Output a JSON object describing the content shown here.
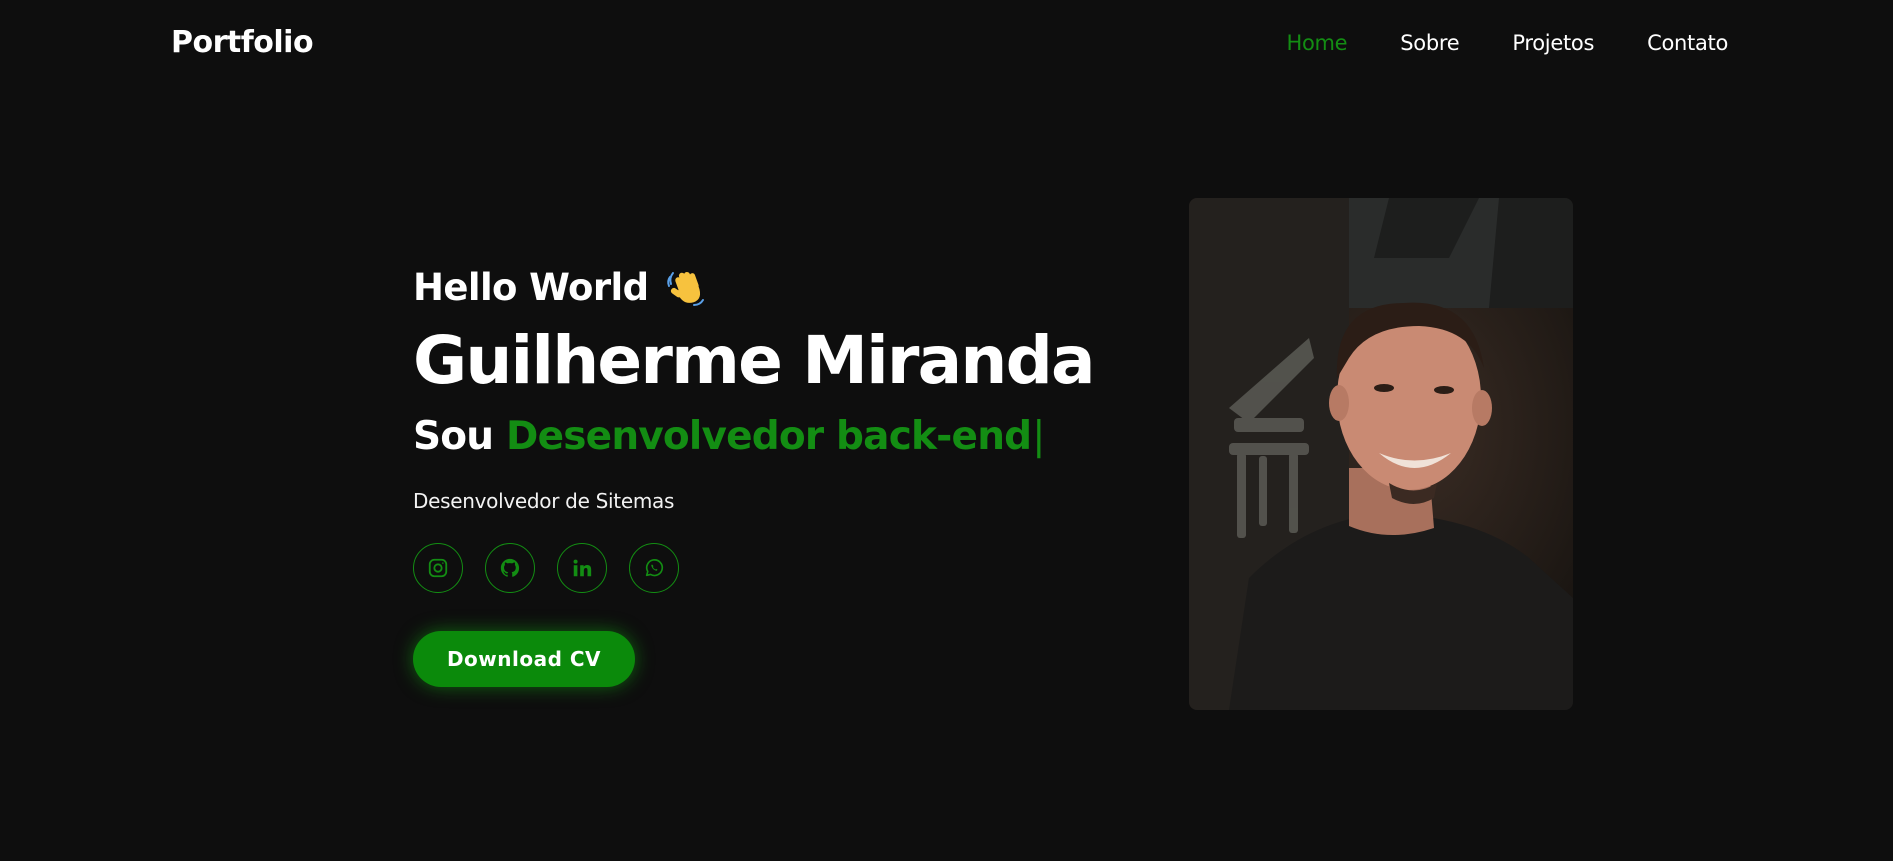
{
  "header": {
    "logo": "Portfolio",
    "nav": [
      {
        "label": "Home",
        "active": true
      },
      {
        "label": "Sobre",
        "active": false
      },
      {
        "label": "Projetos",
        "active": false
      },
      {
        "label": "Contato",
        "active": false
      }
    ]
  },
  "hero": {
    "greeting": "Hello World",
    "greeting_icon": "waving-hand-icon",
    "name": "Guilherme Miranda",
    "role_prefix": "Sou",
    "role_highlight": "Desenvolvedor back-end",
    "cursor": "|",
    "subtitle": "Desenvolvedor de Sitemas",
    "socials": [
      "instagram-icon",
      "github-icon",
      "linkedin-icon",
      "whatsapp-icon"
    ],
    "cv_button": "Download CV"
  },
  "photo": {
    "alt": "profile-photo"
  },
  "colors": {
    "background": "#0e0e0e",
    "accent": "#138d13",
    "text": "#ffffff"
  }
}
